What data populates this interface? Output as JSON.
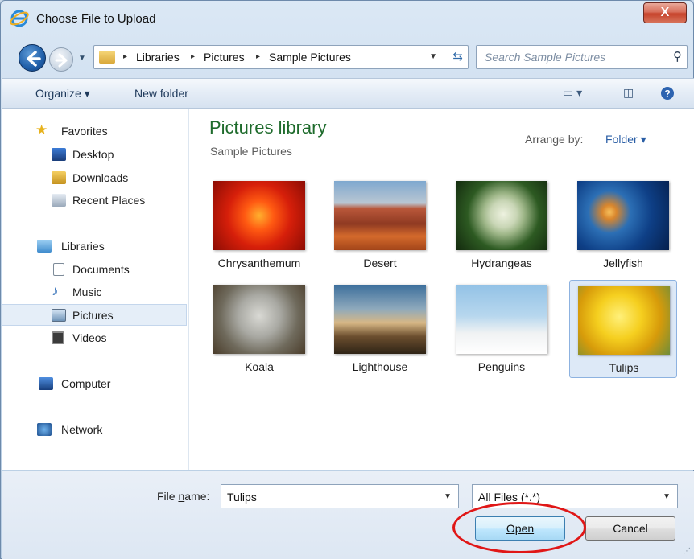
{
  "window": {
    "title": "Choose File to Upload",
    "close_label": "X"
  },
  "address": {
    "crumbs": [
      "Libraries",
      "Pictures",
      "Sample Pictures"
    ],
    "separator": "▸"
  },
  "search": {
    "placeholder": "Search Sample Pictures"
  },
  "toolbar": {
    "organize_label": "Organize ▾",
    "new_folder_label": "New folder"
  },
  "nav": {
    "favorites": "Favorites",
    "desktop": "Desktop",
    "downloads": "Downloads",
    "recent_places": "Recent Places",
    "libraries": "Libraries",
    "documents": "Documents",
    "music": "Music",
    "pictures": "Pictures",
    "videos": "Videos",
    "computer": "Computer",
    "network": "Network"
  },
  "library": {
    "title": "Pictures library",
    "subtitle": "Sample Pictures",
    "arrange_label": "Arrange by:",
    "arrange_value": "Folder ▾"
  },
  "files": [
    {
      "name": "Chrysanthemum",
      "selected": false
    },
    {
      "name": "Desert",
      "selected": false
    },
    {
      "name": "Hydrangeas",
      "selected": false
    },
    {
      "name": "Jellyfish",
      "selected": false
    },
    {
      "name": "Koala",
      "selected": false
    },
    {
      "name": "Lighthouse",
      "selected": false
    },
    {
      "name": "Penguins",
      "selected": false
    },
    {
      "name": "Tulips",
      "selected": true
    }
  ],
  "bottom": {
    "filename_label_pre": "File ",
    "filename_label_u": "n",
    "filename_label_post": "ame:",
    "filename_value": "Tulips",
    "filetype_value": "All Files (*.*)",
    "open_label": "Open",
    "cancel_label": "Cancel"
  },
  "colors": {
    "annotation": "#e01717",
    "library_title": "#1e6b2c",
    "link_blue": "#2a5ea5"
  }
}
